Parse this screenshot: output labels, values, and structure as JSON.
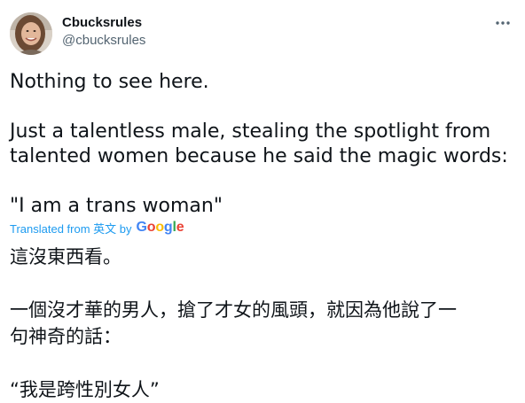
{
  "tweet": {
    "author": {
      "display_name": "Cbucksrules",
      "handle": "@cbucksrules"
    },
    "more_icon": "more-horizontal-icon",
    "text_lines": [
      "Nothing to see here.",
      "Just a talentless male, stealing the spotlight from",
      "talented women because he said the magic words:",
      "\"I am a trans woman\""
    ],
    "translation": {
      "label": "Translated from 英文 by",
      "provider": "Google",
      "provider_colors": [
        "#4285f4",
        "#ea4335",
        "#fbbc05",
        "#4285f4",
        "#34a853",
        "#ea4335"
      ],
      "lines": [
        "這沒東西看。",
        "一個沒才華的男人，搶了才女的風頭，就因為他說了一",
        "句神奇的話：",
        "“我是跨性別女人”"
      ]
    }
  }
}
